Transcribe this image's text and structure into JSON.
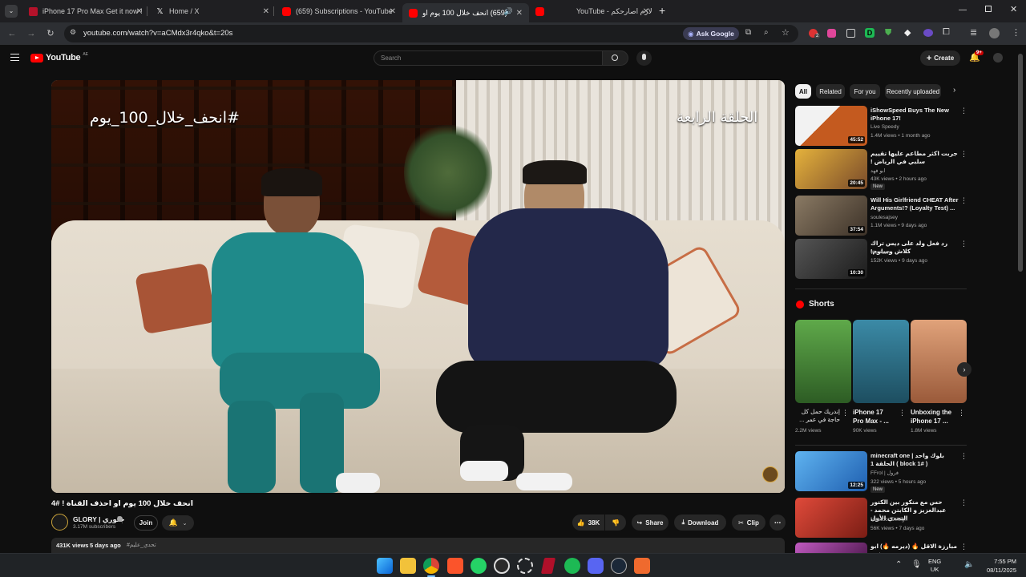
{
  "browser": {
    "tabs": [
      {
        "title": "iPhone 17 Pro Max Get it now !",
        "favicon_color": "#b3122a"
      },
      {
        "title": "Home / X",
        "favicon_color": "#ffffff"
      },
      {
        "title": "(659) Subscriptions - YouTube",
        "favicon_color": "#ff0000"
      },
      {
        "title": "(659) انحف خلال 100 يوم او",
        "favicon_color": "#ff0000"
      },
      {
        "title": "YouTube - لازم اصارحكم",
        "favicon_color": "#ff0000"
      }
    ],
    "new_tab": "+",
    "address": "youtube.com/watch?v=aCMdx3r4qko&t=20s",
    "ask_google": "Ask Google",
    "notification_count": "2"
  },
  "youtube": {
    "logo": "YouTube",
    "region": "AE",
    "search_placeholder": "Search",
    "create_label": "Create",
    "notif_badge": "9+",
    "video": {
      "overlay_left": "#انحف_خلال_100_يوم",
      "overlay_right": "الحلقة الرابعة",
      "title": "انحف خلال 100 يوم او احذف القناة ! #4",
      "channel": "GLORY | جلوري",
      "subscribers": "3.17M subscribers",
      "join": "Join",
      "likes": "38K",
      "share": "Share",
      "download": "Download",
      "clip": "Clip",
      "views": "431K views",
      "age": "5 days ago",
      "hashtag": "#تحدي_عليم"
    },
    "filters": [
      "All",
      "Related",
      "For you",
      "Recently uploaded"
    ],
    "recommendations": [
      {
        "title": "iShowSpeed Buys The New iPhone 17!",
        "channel": "Live Speedy",
        "meta": "1.4M views • 1 month ago",
        "duration": "45:52",
        "thumb": "#c45a1f"
      },
      {
        "title": "جربت اكثر مطاعم عليها تقييم سلبي في الرياض !",
        "channel": "ابو فهد",
        "meta": "43K views • 2 hours ago",
        "badge": "New",
        "duration": "20:45",
        "thumb": "#d2a032"
      },
      {
        "title": "Will His Girlfriend CHEAT After Arguments!? (Loyalty Test) ...",
        "channel": "soulesajsey",
        "meta": "1.1M views • 9 days ago",
        "duration": "37:54",
        "thumb": "#6b5a44"
      },
      {
        "title": "رد فعل ولد على ديس تراك كلاش وسلوم!",
        "channel": "We Aam",
        "meta": "152K views • 9 days ago",
        "duration": "10:30",
        "thumb": "#3a3a3a"
      }
    ],
    "shorts_label": "Shorts",
    "shorts": [
      {
        "title": "إندريك حمل كل حاجة في عمر ...",
        "views": "2.2M views",
        "thumb": "#4f8a3a"
      },
      {
        "title": "iPhone 17 Pro Max - ...",
        "views": "90K views",
        "thumb": "#2f6f86"
      },
      {
        "title": "Unboxing the iPhone 17 ...",
        "views": "1.8M views",
        "thumb": "#c98560"
      }
    ],
    "more_recs": [
      {
        "title": "minecraft one | بلوك واحد الحلقة 1 ( block 1# )",
        "channel": "FFrol | فرول",
        "meta": "322 views • 5 hours ago",
        "badge": "New",
        "duration": "12:25",
        "thumb": "#2c74c9"
      },
      {
        "title": "حس مع متكور بين الكتور عبدالعزيز و الكابتن محمد - التحدي الأول",
        "channel": "Matador Design",
        "meta": "56K views • 7 days ago",
        "duration": "",
        "thumb": "#c0392b"
      },
      {
        "title": "مبارزة الاقل 🔥 (ديرمه 🔥) ابو فهد",
        "channel": "",
        "meta": "",
        "duration": "",
        "thumb": "#8e3b8e"
      }
    ]
  },
  "taskbar": {
    "lang_top": "ENG",
    "lang_bottom": "UK",
    "time": "7:55 PM",
    "date": "08/11/2025"
  }
}
